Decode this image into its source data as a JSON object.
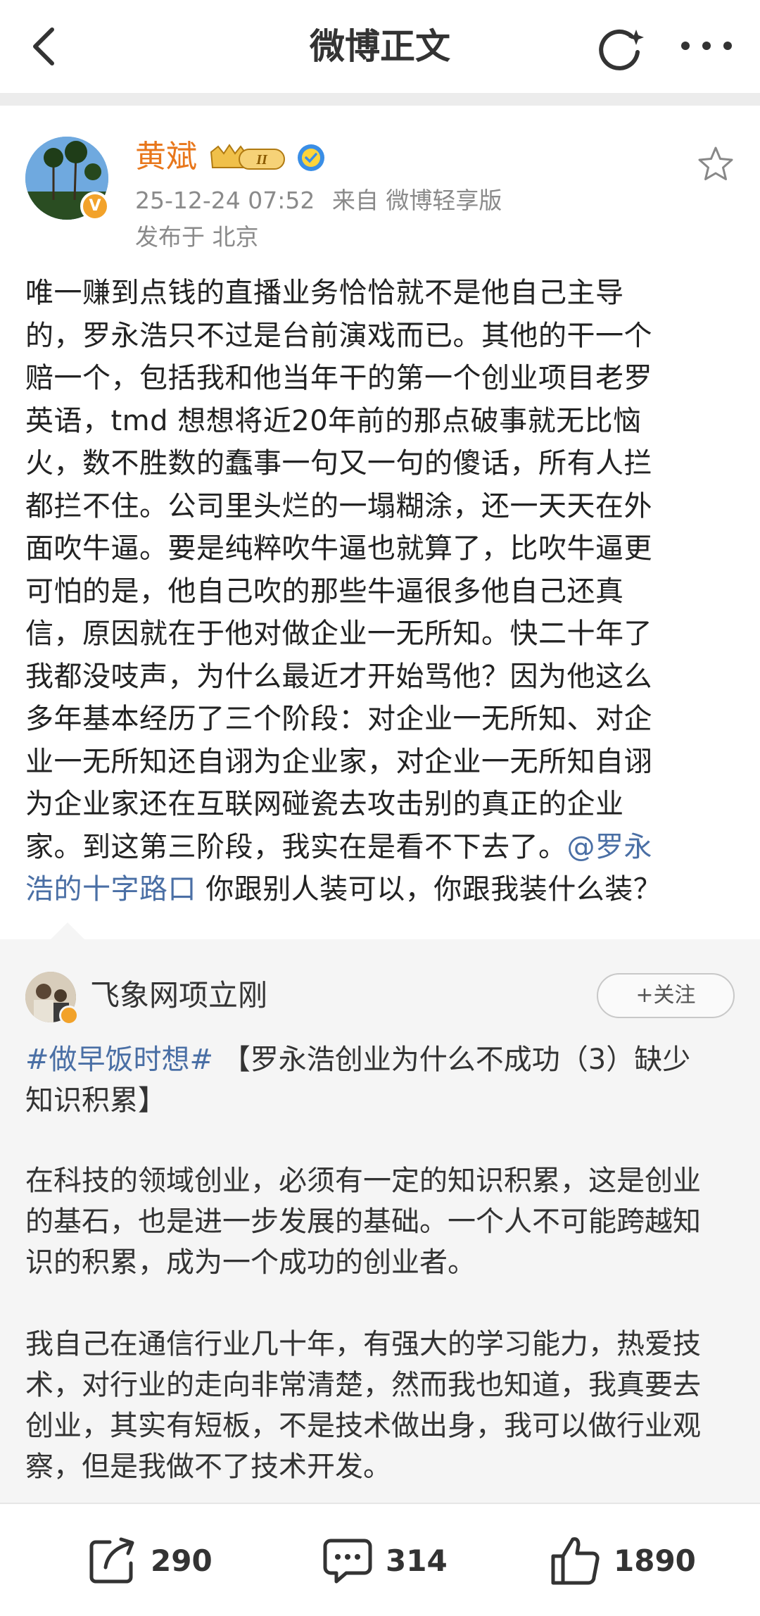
{
  "nav": {
    "title": "微博正文"
  },
  "post": {
    "author": "黄斌",
    "vip_level": "II",
    "time": "25-12-24 07:52",
    "source": "来自 微博轻享版",
    "location": "发布于 北京",
    "body_lines": [
      "唯一赚到点钱的直播业务恰恰就不是他自己主导",
      "的，罗永浩只不过是台前演戏而已。其他的干一个",
      "赔一个，包括我和他当年干的第一个创业项目老罗",
      "英语，tmd 想想将近20年前的那点破事就无比恼",
      "火，数不胜数的蠢事一句又一句的傻话，所有人拦",
      "都拦不住。公司里头烂的一塌糊涂，还一天天在外",
      "面吹牛逼。要是纯粹吹牛逼也就算了，比吹牛逼更",
      "可怕的是，他自己吹的那些牛逼很多他自己还真",
      "信，原因就在于他对做企业一无所知。快二十年了",
      "我都没吱声，为什么最近才开始骂他？因为他这么",
      "多年基本经历了三个阶段：对企业一无所知、对企",
      "业一无所知还自诩为企业家，对企业一无所知自诩",
      "为企业家还在互联网碰瓷去攻击别的真正的企业"
    ],
    "last_line_a": "家。到这第三阶段，我实在是看不下去了。",
    "mention_a": "@罗永",
    "mention_b": "浩的十字路口",
    "last_line_b": " 你跟别人装可以，你跟我装什么装？"
  },
  "retweet": {
    "author": "飞象网项立刚",
    "follow_label": "+关注",
    "topic": "#做早饭时想#",
    "title_a": " 【罗永浩创业为什么不成功（3）缺少",
    "title_b": "知识积累】",
    "para1_lines": [
      "在科技的领域创业，必须有一定的知识积累，这是创业",
      "的基石，也是进一步发展的基础。一个人不可能跨越知",
      "识的积累，成为一个成功的创业者。"
    ],
    "para2_lines": [
      "我自己在通信行业几十年，有强大的学习能力，热爱技",
      "术，对行业的走向非常清楚，然而我也知道，我真要去",
      "创业，其实有短板，不是技术做出身，我可以做行业观",
      "察，但是我做不了技术开发。"
    ]
  },
  "actions": {
    "repost_count": "290",
    "comment_count": "314",
    "like_count": "1890"
  },
  "colors": {
    "accent_orange": "#e8771c",
    "link_blue": "#4a6fa5",
    "muted": "#8a8a8a"
  }
}
